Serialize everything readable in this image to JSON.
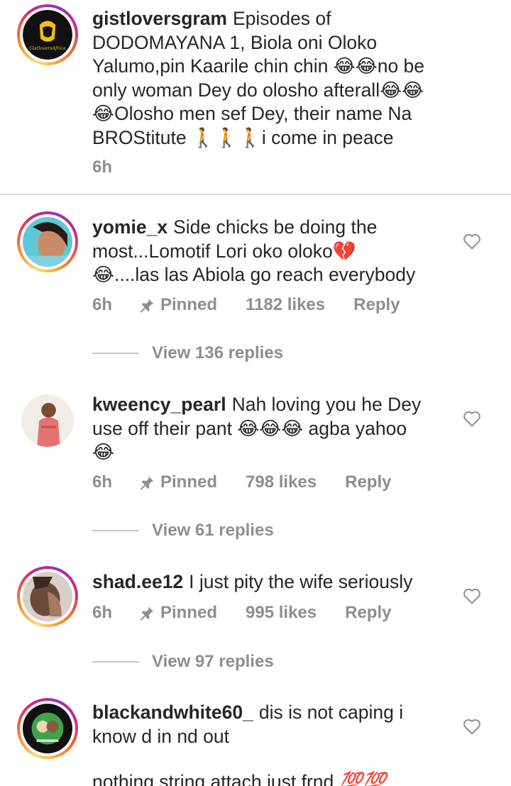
{
  "caption": {
    "username": "gistloversgram",
    "text_lines": [
      "Episodes of",
      "DODOMAYANA 1, Biola oni Oloko",
      "Yalumo,pin  Kaarile chin chin 😂😂no be",
      "only woman Dey do olosho afterall😂😂",
      "😂Olosho men sef Dey, their name Na",
      "BROStitute 🚶🚶🚶i come in peace"
    ],
    "time": "6h",
    "avatar_icon": "gistlovers-africa-logo"
  },
  "comments": [
    {
      "username": "yomie_x",
      "text_lines": [
        "Side chicks be doing the",
        "most...Lomotif Lori oko oloko💔",
        "😂....las las Abiola go reach everybody"
      ],
      "time": "6h",
      "pinned_label": "Pinned",
      "likes": "1182 likes",
      "reply_label": "Reply",
      "view_replies": "View 136 replies",
      "avatar_icon": "profile-photo"
    },
    {
      "username": "kweency_pearl",
      "text_lines": [
        "Nah loving you he Dey",
        "use off their pant 😂😂😂 agba yahoo",
        "😂"
      ],
      "time": "6h",
      "pinned_label": "Pinned",
      "likes": "798 likes",
      "reply_label": "Reply",
      "view_replies": "View 61 replies",
      "avatar_icon": "profile-photo"
    },
    {
      "username": "shad.ee12",
      "text_lines": [
        "I just pity the wife seriously"
      ],
      "time": "6h",
      "pinned_label": "Pinned",
      "likes": "995 likes",
      "reply_label": "Reply",
      "view_replies": "View 97 replies",
      "avatar_icon": "profile-photo"
    },
    {
      "username": "blackandwhite60_",
      "text_lines": [
        "dis is not caping i",
        "know d in nd out"
      ],
      "extra_line": "nothing string attach just frnd",
      "extra_emoji": "💯💯",
      "avatar_icon": "profile-photo"
    }
  ],
  "colors": {
    "text": "#262626",
    "secondary": "#8e8e8e",
    "divider": "#dbdbdb",
    "story_ring_start": "#feda75",
    "story_ring_end": "#962fbf"
  }
}
